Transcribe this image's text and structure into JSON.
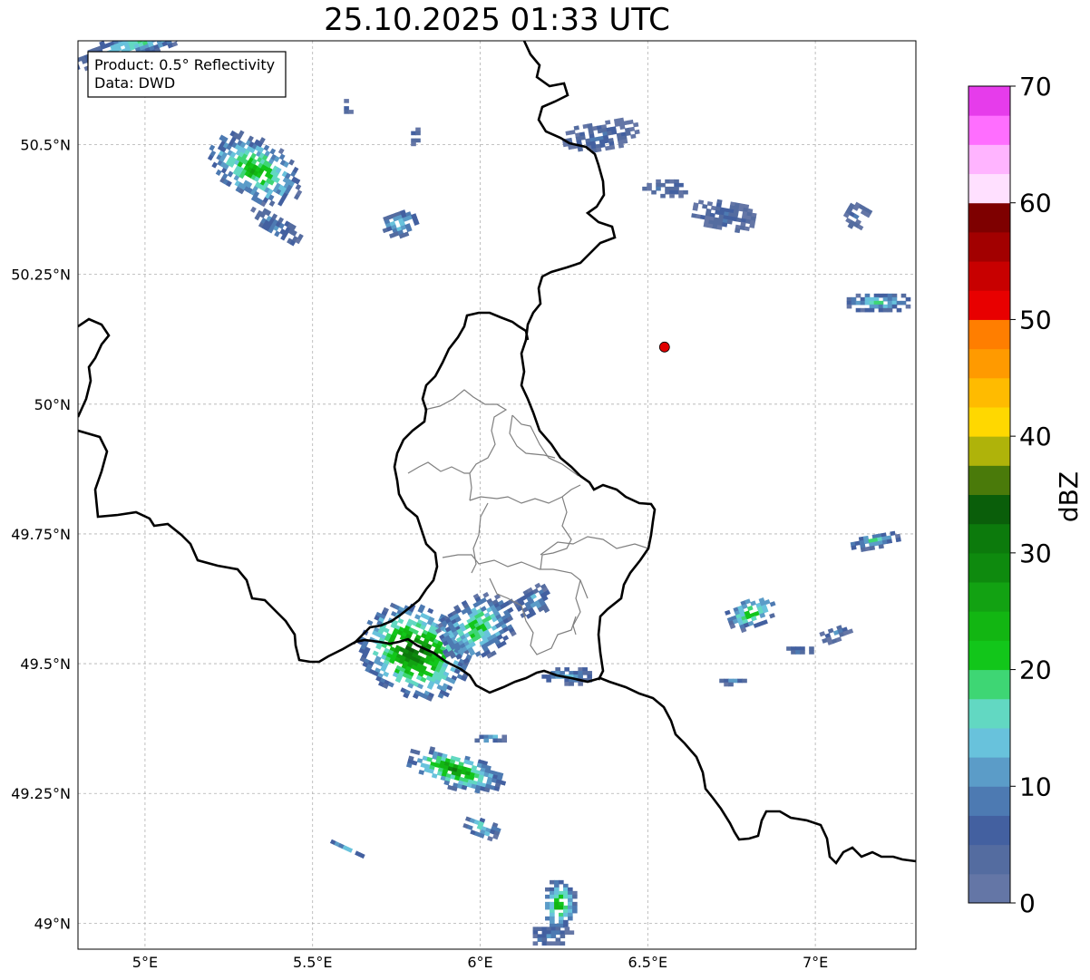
{
  "title": "25.10.2025 01:33 UTC",
  "info_box": {
    "product": "Product: 0.5° Reflectivity",
    "data": "Data: DWD"
  },
  "map": {
    "lon_range": [
      4.8,
      7.3
    ],
    "lat_range": [
      48.95,
      50.7
    ],
    "lon_ticks": [
      {
        "value": 5.0,
        "label": "5°E"
      },
      {
        "value": 5.5,
        "label": "5.5°E"
      },
      {
        "value": 6.0,
        "label": "6°E"
      },
      {
        "value": 6.5,
        "label": "6.5°E"
      },
      {
        "value": 7.0,
        "label": "7°E"
      }
    ],
    "lat_ticks": [
      {
        "value": 50.5,
        "label": "50.5°N"
      },
      {
        "value": 50.25,
        "label": "50.25°N"
      },
      {
        "value": 50.0,
        "label": "50°N"
      },
      {
        "value": 49.75,
        "label": "49.75°N"
      },
      {
        "value": 49.5,
        "label": "49.5°N"
      },
      {
        "value": 49.25,
        "label": "49.25°N"
      },
      {
        "value": 49.0,
        "label": "49°N"
      }
    ],
    "gridlines": true,
    "radar_site": {
      "lon": 6.55,
      "lat": 50.11,
      "color": "#e00000"
    },
    "colors": {
      "border": "#000000",
      "district": "#7f7f7f",
      "grid": "#b0b0b0"
    }
  },
  "colorbar": {
    "label": "dBZ",
    "ticks": [
      0,
      10,
      20,
      30,
      40,
      50,
      60,
      70
    ],
    "min": 0,
    "max": 70,
    "colors": [
      "#6476a6",
      "#546ca0",
      "#4360a0",
      "#4d7ab2",
      "#5b9cc8",
      "#68c2dc",
      "#62d8c2",
      "#3ed674",
      "#12c61a",
      "#12b612",
      "#12a212",
      "#0e8a0e",
      "#0c7a0c",
      "#0a5e0a",
      "#4a7a0a",
      "#afb30a",
      "#ffd800",
      "#ffbb00",
      "#ff9a00",
      "#ff7e00",
      "#e80000",
      "#c80000",
      "#a20000",
      "#7e0000",
      "#ffe0ff",
      "#ffb4ff",
      "#ff6eff",
      "#e63ceb"
    ]
  },
  "echoes": [
    {
      "lon": 5.32,
      "lat": 50.45,
      "rlon": 0.09,
      "rlat": 0.1,
      "angle": -60,
      "peak": 26
    },
    {
      "lon": 5.38,
      "lat": 50.34,
      "rlon": 0.03,
      "rlat": 0.06,
      "angle": -60,
      "peak": 12
    },
    {
      "lon": 5.75,
      "lat": 50.35,
      "rlon": 0.06,
      "rlat": 0.025,
      "angle": -20,
      "peak": 16
    },
    {
      "lon": 6.35,
      "lat": 50.52,
      "rlon": 0.12,
      "rlat": 0.03,
      "angle": -10,
      "peak": 8
    },
    {
      "lon": 6.55,
      "lat": 50.42,
      "rlon": 0.08,
      "rlat": 0.02,
      "angle": 0,
      "peak": 7
    },
    {
      "lon": 6.72,
      "lat": 50.37,
      "rlon": 0.1,
      "rlat": 0.03,
      "angle": 10,
      "peak": 7
    },
    {
      "lon": 7.12,
      "lat": 50.37,
      "rlon": 0.04,
      "rlat": 0.025,
      "angle": 30,
      "peak": 6
    },
    {
      "lon": 7.18,
      "lat": 50.2,
      "rlon": 0.1,
      "rlat": 0.02,
      "angle": 0,
      "peak": 18
    },
    {
      "lon": 5.8,
      "lat": 49.53,
      "rlon": 0.17,
      "rlat": 0.09,
      "angle": 25,
      "peak": 34
    },
    {
      "lon": 5.98,
      "lat": 49.57,
      "rlon": 0.13,
      "rlat": 0.06,
      "angle": -30,
      "peak": 22
    },
    {
      "lon": 6.15,
      "lat": 49.62,
      "rlon": 0.06,
      "rlat": 0.03,
      "angle": -30,
      "peak": 14
    },
    {
      "lon": 6.25,
      "lat": 49.48,
      "rlon": 0.08,
      "rlat": 0.02,
      "angle": 0,
      "peak": 14
    },
    {
      "lon": 5.92,
      "lat": 49.3,
      "rlon": 0.15,
      "rlat": 0.035,
      "angle": 15,
      "peak": 30
    },
    {
      "lon": 6.02,
      "lat": 49.36,
      "rlon": 0.05,
      "rlat": 0.01,
      "angle": 0,
      "peak": 18
    },
    {
      "lon": 6.0,
      "lat": 49.19,
      "rlon": 0.06,
      "rlat": 0.02,
      "angle": 20,
      "peak": 20
    },
    {
      "lon": 6.23,
      "lat": 49.04,
      "rlon": 0.05,
      "rlat": 0.05,
      "angle": 0,
      "peak": 26
    },
    {
      "lon": 6.2,
      "lat": 48.98,
      "rlon": 0.07,
      "rlat": 0.02,
      "angle": 0,
      "peak": 10
    },
    {
      "lon": 6.8,
      "lat": 49.6,
      "rlon": 0.08,
      "rlat": 0.03,
      "angle": -20,
      "peak": 24
    },
    {
      "lon": 7.17,
      "lat": 49.74,
      "rlon": 0.08,
      "rlat": 0.015,
      "angle": -10,
      "peak": 18
    },
    {
      "lon": 7.05,
      "lat": 49.56,
      "rlon": 0.05,
      "rlat": 0.015,
      "angle": -20,
      "peak": 10
    },
    {
      "lon": 6.95,
      "lat": 49.53,
      "rlon": 0.05,
      "rlat": 0.01,
      "angle": 0,
      "peak": 10
    },
    {
      "lon": 5.6,
      "lat": 49.15,
      "rlon": 0.06,
      "rlat": 0.006,
      "angle": 25,
      "peak": 14
    },
    {
      "lon": 4.98,
      "lat": 50.7,
      "rlon": 0.22,
      "rlat": 0.03,
      "angle": -20,
      "peak": 18
    },
    {
      "lon": 5.8,
      "lat": 50.52,
      "rlon": 0.02,
      "rlat": 0.02,
      "angle": 0,
      "peak": 8
    },
    {
      "lon": 5.6,
      "lat": 50.58,
      "rlon": 0.02,
      "rlat": 0.015,
      "angle": 0,
      "peak": 8
    },
    {
      "lon": 6.75,
      "lat": 49.47,
      "rlon": 0.05,
      "rlat": 0.008,
      "angle": 0,
      "peak": 12
    }
  ]
}
